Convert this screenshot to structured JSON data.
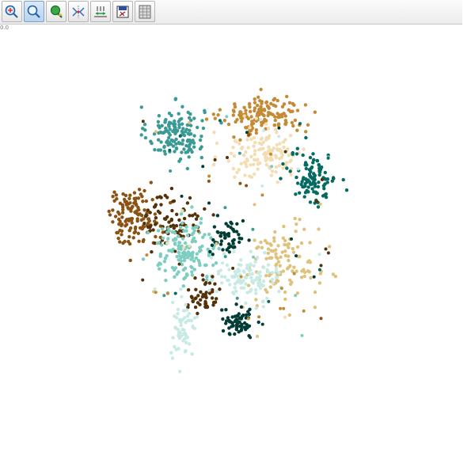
{
  "toolbar": {
    "tools": [
      {
        "name": "zoom-in-tool",
        "icon": "zoom-in-icon",
        "active": false
      },
      {
        "name": "zoom-tool",
        "icon": "magnifier-icon",
        "active": true
      },
      {
        "name": "select-tool",
        "icon": "lasso-select-icon",
        "active": false
      },
      {
        "name": "pan-tool",
        "icon": "pan-arrows-icon",
        "active": false
      },
      {
        "name": "axis-scale-tool",
        "icon": "axis-scale-icon",
        "active": false
      },
      {
        "name": "export-tool",
        "icon": "save-export-icon",
        "active": false
      },
      {
        "name": "grid-tool",
        "icon": "grid-icon",
        "active": false
      }
    ]
  },
  "plot": {
    "corner_label": "0.0"
  },
  "chart_data": {
    "type": "scatter",
    "description_free": true,
    "xlim": [
      0,
      100
    ],
    "ylim": [
      0,
      100
    ],
    "grid": false,
    "clusters": [
      {
        "color": "#3a9a94",
        "center": [
          37.0,
          76.0
        ],
        "spread": [
          3.5,
          3.5
        ],
        "count": 150
      },
      {
        "color": "#c58a34",
        "center": [
          55.5,
          80.0
        ],
        "spread": [
          5.0,
          2.5
        ],
        "count": 150
      },
      {
        "color": "#f3ddb2",
        "center": [
          56.0,
          71.5
        ],
        "spread": [
          5.0,
          3.5
        ],
        "count": 130
      },
      {
        "color": "#046b63",
        "center": [
          66.0,
          66.0
        ],
        "spread": [
          2.8,
          3.5
        ],
        "count": 110
      },
      {
        "color": "#8c5214",
        "center": [
          28.0,
          57.5
        ],
        "spread": [
          3.2,
          3.5
        ],
        "count": 130
      },
      {
        "color": "#543209",
        "center": [
          36.5,
          57.0
        ],
        "spread": [
          3.5,
          3.5
        ],
        "count": 80
      },
      {
        "color": "#7dcdc1",
        "center": [
          39.0,
          50.0
        ],
        "spread": [
          4.5,
          4.0
        ],
        "count": 150
      },
      {
        "color": "#013d35",
        "center": [
          48.0,
          52.5
        ],
        "spread": [
          2.0,
          2.5
        ],
        "count": 50
      },
      {
        "color": "#dfc27d",
        "center": [
          59.5,
          47.0
        ],
        "spread": [
          4.5,
          5.0
        ],
        "count": 120
      },
      {
        "color": "#c7eae5",
        "center": [
          52.0,
          44.0
        ],
        "spread": [
          4.0,
          3.0
        ],
        "count": 110
      },
      {
        "color": "#543209",
        "center": [
          43.0,
          40.0
        ],
        "spread": [
          2.0,
          2.0
        ],
        "count": 50
      },
      {
        "color": "#013d35",
        "center": [
          50.0,
          34.0
        ],
        "spread": [
          2.0,
          2.0
        ],
        "count": 60
      },
      {
        "color": "#c7eae5",
        "center": [
          38.5,
          32.0
        ],
        "spread": [
          1.5,
          3.5
        ],
        "count": 60
      }
    ]
  }
}
